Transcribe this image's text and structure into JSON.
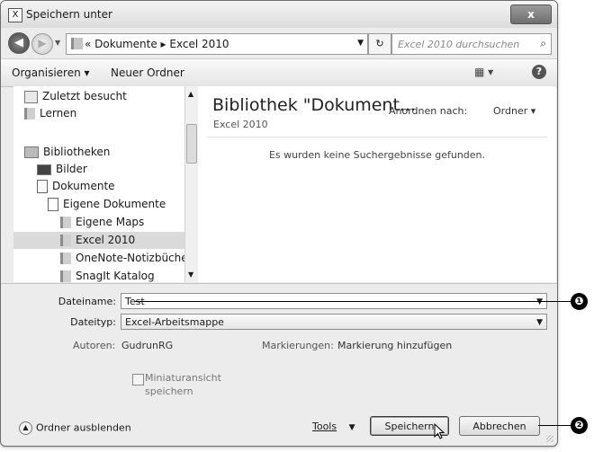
{
  "window": {
    "title": "Speichern unter",
    "close_glyph": "x",
    "app_icon_glyph": "X"
  },
  "nav": {
    "back_glyph": "◀",
    "forward_glyph": "▶",
    "breadcrumb_prefix": "«",
    "breadcrumb": [
      "Dokumente",
      "Excel 2010"
    ],
    "refresh_glyph": "↻",
    "search_placeholder": "Excel 2010 durchsuchen"
  },
  "toolbar": {
    "organize": "Organisieren ▾",
    "new_folder": "Neuer Ordner",
    "view_glyph": "▦ ▾",
    "help_glyph": "?"
  },
  "tree": [
    {
      "label": "Zuletzt besucht",
      "icon": "recent-places-icon",
      "indent": 0
    },
    {
      "label": "Lernen",
      "icon": "folder-icon",
      "indent": 0
    },
    {
      "label": "Bibliotheken",
      "icon": "libraries-icon",
      "indent": 0
    },
    {
      "label": "Bilder",
      "icon": "pictures-library-icon",
      "indent": 1
    },
    {
      "label": "Dokumente",
      "icon": "documents-library-icon",
      "indent": 1
    },
    {
      "label": "Eigene Dokumente",
      "icon": "document-folder-icon",
      "indent": 2
    },
    {
      "label": "Eigene Maps",
      "icon": "folder-icon",
      "indent": 3
    },
    {
      "label": "Excel 2010",
      "icon": "folder-icon",
      "indent": 3,
      "selected": true
    },
    {
      "label": "OneNote-Notizbücher",
      "icon": "folder-icon",
      "indent": 3
    },
    {
      "label": "SnagIt Katalog",
      "icon": "folder-icon",
      "indent": 3
    }
  ],
  "content": {
    "library_title": "Bibliothek \"Dokument...",
    "library_subtitle": "Excel 2010",
    "arrange_label": "Anordnen nach:",
    "arrange_value": "Ordner ▾",
    "empty_message": "Es wurden keine Suchergebnisse gefunden."
  },
  "form": {
    "filename_label": "Dateiname:",
    "filename_value": "Test",
    "filetype_label": "Dateityp:",
    "filetype_value": "Excel-Arbeitsmappe",
    "authors_label": "Autoren:",
    "authors_value": "GudrunRG",
    "tags_label": "Markierungen:",
    "tags_value": "Markierung hinzufügen",
    "thumbnail_line1": "Miniaturansicht",
    "thumbnail_line2": "speichern"
  },
  "footer": {
    "hide_folders": "Ordner ausblenden",
    "tools": "Tools",
    "save": "Speichern",
    "cancel": "Abbrechen"
  },
  "callouts": [
    "❶",
    "❷"
  ]
}
